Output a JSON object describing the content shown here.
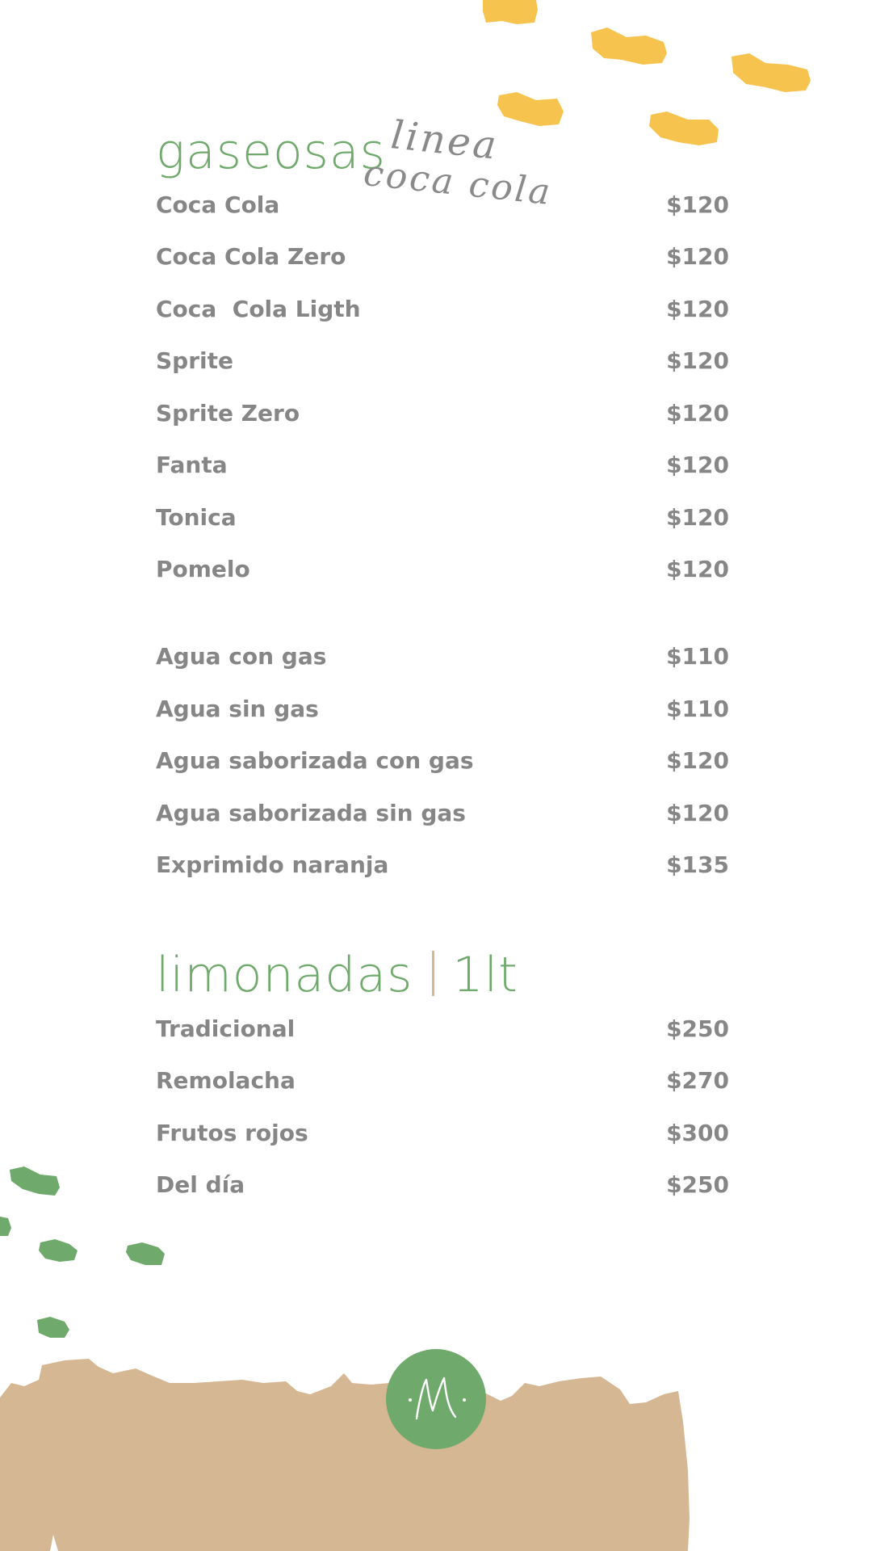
{
  "colors": {
    "title_green": "#6faa6c",
    "text_gray": "#868686",
    "accent_yellow": "#f7c34f",
    "sand": "#d6b794",
    "separator": "#d6b794"
  },
  "gaseosas": {
    "title": "gaseosas",
    "script_line1": "linea",
    "script_line2": "coca cola",
    "items": [
      {
        "name": "Coca Cola",
        "price": "$120"
      },
      {
        "name": "Coca Cola Zero",
        "price": "$120"
      },
      {
        "name": "Coca  Cola Ligth",
        "price": "$120"
      },
      {
        "name": "Sprite",
        "price": "$120"
      },
      {
        "name": "Sprite Zero",
        "price": "$120"
      },
      {
        "name": "Fanta",
        "price": "$120"
      },
      {
        "name": "Tonica",
        "price": "$120"
      },
      {
        "name": "Pomelo",
        "price": "$120"
      }
    ]
  },
  "aguas": {
    "items": [
      {
        "name": "Agua con gas",
        "price": "$110"
      },
      {
        "name": "Agua sin gas",
        "price": "$110"
      },
      {
        "name": "Agua saborizada con gas",
        "price": "$120"
      },
      {
        "name": "Agua saborizada sin gas",
        "price": "$120"
      },
      {
        "name": "Exprimido naranja",
        "price": "$135"
      }
    ]
  },
  "limonadas": {
    "title": "limonadas",
    "size": "1lt",
    "items": [
      {
        "name": "Tradicional",
        "price": "$250"
      },
      {
        "name": "Remolacha",
        "price": "$270"
      },
      {
        "name": "Frutos rojos",
        "price": "$300"
      },
      {
        "name": "Del día",
        "price": "$250"
      }
    ]
  },
  "logo": {
    "letter": "M"
  }
}
